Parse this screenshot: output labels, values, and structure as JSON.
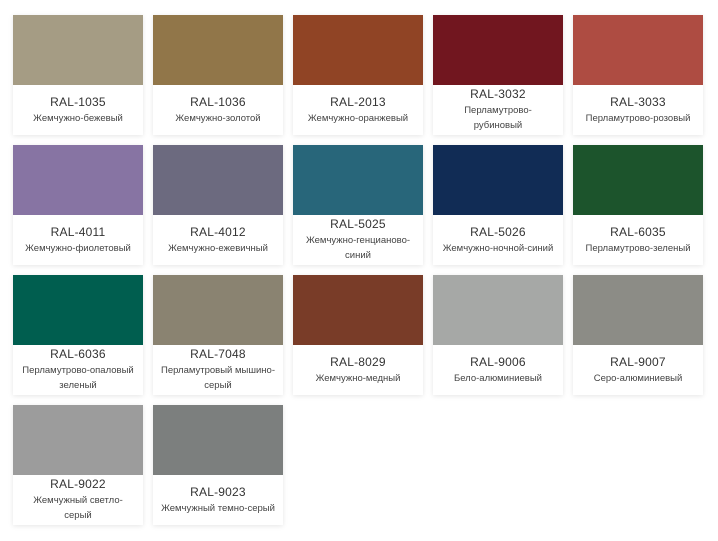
{
  "colors": [
    {
      "code": "RAL-1035",
      "name": "Жемчужно-бежевый",
      "hex": "#a59c84"
    },
    {
      "code": "RAL-1036",
      "name": "Жемчужно-золотой",
      "hex": "#917649"
    },
    {
      "code": "RAL-2013",
      "name": "Жемчужно-оранжевый",
      "hex": "#904425"
    },
    {
      "code": "RAL-3032",
      "name": "Перламутрово-рубиновый",
      "hex": "#71161f"
    },
    {
      "code": "RAL-3033",
      "name": "Перламутрово-розовый",
      "hex": "#ae4c42"
    },
    {
      "code": "RAL-4011",
      "name": "Жемчужно-фиолетовый",
      "hex": "#8774a3"
    },
    {
      "code": "RAL-4012",
      "name": "Жемчужно-ежевичный",
      "hex": "#6c6a7f"
    },
    {
      "code": "RAL-5025",
      "name": "Жемчужно-генцианово-синий",
      "hex": "#28667a"
    },
    {
      "code": "RAL-5026",
      "name": "Жемчужно-ночной-синий",
      "hex": "#112c55"
    },
    {
      "code": "RAL-6035",
      "name": "Перламутрово-зеленый",
      "hex": "#1c542c"
    },
    {
      "code": "RAL-6036",
      "name": "Перламутрово-опаловый зеленый",
      "hex": "#005e4f"
    },
    {
      "code": "RAL-7048",
      "name": "Перламутровый мышино-серый",
      "hex": "#8a8371"
    },
    {
      "code": "RAL-8029",
      "name": "Жемчужно-медный",
      "hex": "#793c28"
    },
    {
      "code": "RAL-9006",
      "name": "Бело-алюминиевый",
      "hex": "#a6a8a6"
    },
    {
      "code": "RAL-9007",
      "name": "Серо-алюминиевый",
      "hex": "#8c8c86"
    },
    {
      "code": "RAL-9022",
      "name": "Жемчужный светло-серый",
      "hex": "#9c9c9c"
    },
    {
      "code": "RAL-9023",
      "name": "Жемчужный темно-серый",
      "hex": "#7c7f7e"
    }
  ]
}
